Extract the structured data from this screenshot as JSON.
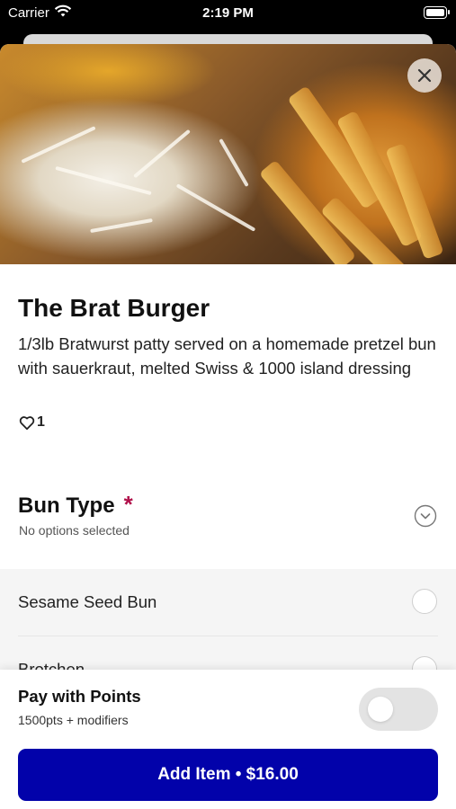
{
  "status_bar": {
    "carrier": "Carrier",
    "time": "2:19 PM"
  },
  "item": {
    "title": "The Brat Burger",
    "description": "1/3lb Bratwurst patty served on a homemade pretzel bun with sauerkraut, melted Swiss & 1000 island dressing",
    "like_count": "1"
  },
  "bun_section": {
    "title": "Bun Type",
    "required_marker": "*",
    "subtitle": "No options selected",
    "options": [
      {
        "label": "Sesame Seed Bun"
      },
      {
        "label": "Brotchen"
      }
    ]
  },
  "footer": {
    "points_label": "Pay with Points",
    "points_sub": "1500pts + modifiers",
    "add_button": "Add Item • $16.00"
  },
  "icons": {
    "close": "close-icon",
    "heart": "heart-icon",
    "chevron": "chevron-down-circle-icon",
    "wifi": "wifi-icon",
    "battery": "battery-icon"
  },
  "colors": {
    "primary": "#0202aa",
    "required": "#b0104a",
    "toggle_off": "#e3e3e3"
  }
}
